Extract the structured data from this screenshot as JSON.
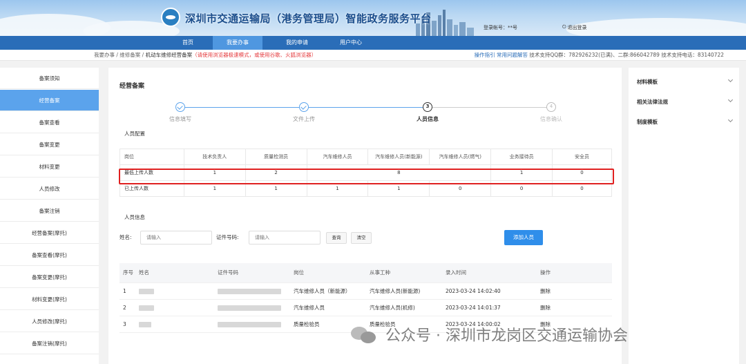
{
  "header": {
    "title": "深圳市交通运输局（港务管理局）智能政务服务平台",
    "login_info": "登录帐号：**号",
    "logout": "退出登录"
  },
  "nav": [
    "首页",
    "我要办事",
    "我的申请",
    "用户中心"
  ],
  "breadcrumb": {
    "path": "我要办事 / 维修备案 / ",
    "current": "机动车维修经营备案",
    "warning": "（请使用浏览器极速模式，或使用谷歌、火狐浏览器）"
  },
  "support": {
    "guide": "操作指引",
    "faq": "常用问题解答",
    "text": "技术支持QQ群：782926232(已满)、二群:866042789 技术支持电话：83140722"
  },
  "sidebar": [
    "备案须知",
    "经营备案",
    "备案查看",
    "备案变更",
    "材料变更",
    "人员修改",
    "备案注销",
    "经营备案(摩托)",
    "备案查看(摩托)",
    "备案变更(摩托)",
    "材料变更(摩托)",
    "人员修改(摩托)",
    "备案注销(摩托)"
  ],
  "page_title": "经营备案",
  "steps": [
    {
      "label": "信息填写",
      "num": "1",
      "state": "done"
    },
    {
      "label": "文件上传",
      "num": "2",
      "state": "done"
    },
    {
      "label": "人员信息",
      "num": "3",
      "state": "current"
    },
    {
      "label": "信息确认",
      "num": "4",
      "state": "pending"
    }
  ],
  "staff_config": {
    "section_label": "人员配置",
    "headers": [
      "岗位",
      "技术负责人",
      "质量检测员",
      "汽车维修人员",
      "汽车维修人员(新能源)",
      "汽车维修人员(燃气)",
      "业务接待员",
      "安全员"
    ],
    "min_row": {
      "label": "最低上传人数",
      "tech": "1",
      "quality": "2",
      "repair_merged": "8",
      "reception": "1",
      "safety": "0"
    },
    "uploaded_row": {
      "label": "已上传人数",
      "values": [
        "1",
        "1",
        "1",
        "1",
        "0",
        "0",
        "0"
      ]
    }
  },
  "person_info": {
    "section_label": "人员信息",
    "name_label": "姓名:",
    "name_placeholder": "请输入",
    "id_label": "证件号码:",
    "id_placeholder": "请输入",
    "query": "查询",
    "clear": "清空",
    "add": "添加人员"
  },
  "list": {
    "headers": [
      "序号",
      "姓名",
      "证件号码",
      "岗位",
      "从事工种",
      "录入时间",
      "操作"
    ],
    "rows": [
      {
        "no": "1",
        "post": "汽车维修人员（新能源）",
        "type": "汽车维修人员(新能源)",
        "time": "2023-03-24 14:02:40",
        "op": "删除"
      },
      {
        "no": "2",
        "post": "汽车维修人员",
        "type": "汽车维修人员(机修)",
        "time": "2023-03-24 14:01:37",
        "op": "删除"
      },
      {
        "no": "3",
        "post": "质量检验员",
        "type": "质量检验员",
        "time": "2023-03-24 14:00:02",
        "op": "删除"
      }
    ]
  },
  "right_panel": [
    "材料模板",
    "相关法律法规",
    "制度模板"
  ],
  "watermark": "公众号 · 深圳市龙岗区交通运输协会",
  "colors": {
    "nav": "#2a6db8",
    "active": "#5ba3ec",
    "primary": "#2f8eea",
    "danger": "#ff4d4f",
    "highlight": "#e02020"
  }
}
